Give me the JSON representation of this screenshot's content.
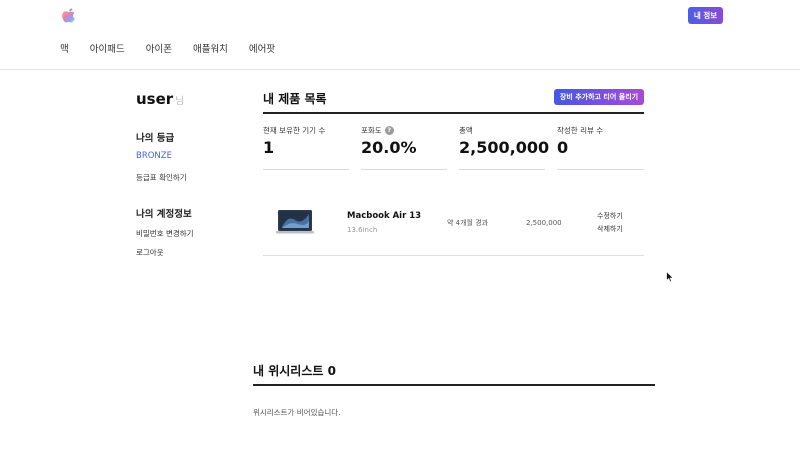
{
  "header": {
    "logo_icon": "apple-logo-icon",
    "my_info_button": "내 정보",
    "nav": [
      "맥",
      "아이패드",
      "아이폰",
      "애플워치",
      "에어팟"
    ]
  },
  "sidebar": {
    "username": "user",
    "username_suffix": "님",
    "grade_heading": "나의 등급",
    "grade_value": "BRONZE",
    "grade_table_link": "등급표 확인하기",
    "account_heading": "나의 계정정보",
    "change_password_link": "비밀번호 변경하기",
    "logout_link": "로그아웃"
  },
  "products": {
    "title": "내 제품 목록",
    "add_button": "장비 추가하고 티어 올리기",
    "stats": [
      {
        "label": "현재 보유한 기기 수",
        "value": "1"
      },
      {
        "label": "포화도",
        "value": "20.0%",
        "help": "?"
      },
      {
        "label": "총액",
        "value": "2,500,000"
      },
      {
        "label": "작성한 리뷰 수",
        "value": "0"
      }
    ],
    "items": [
      {
        "name": "Macbook Air 13",
        "spec": "13.6inch",
        "age": "약 4개월 경과",
        "price": "2,500,000",
        "edit": "수정하기",
        "delete": "삭제하기"
      }
    ]
  },
  "wishlist": {
    "title": "내 위시리스트 0",
    "empty_message": "위시리스트가 비어있습니다."
  },
  "colors": {
    "accent_gradient_start": "#4558e2",
    "accent_gradient_end": "#a84ad8",
    "grade_color": "#4a64c9"
  }
}
